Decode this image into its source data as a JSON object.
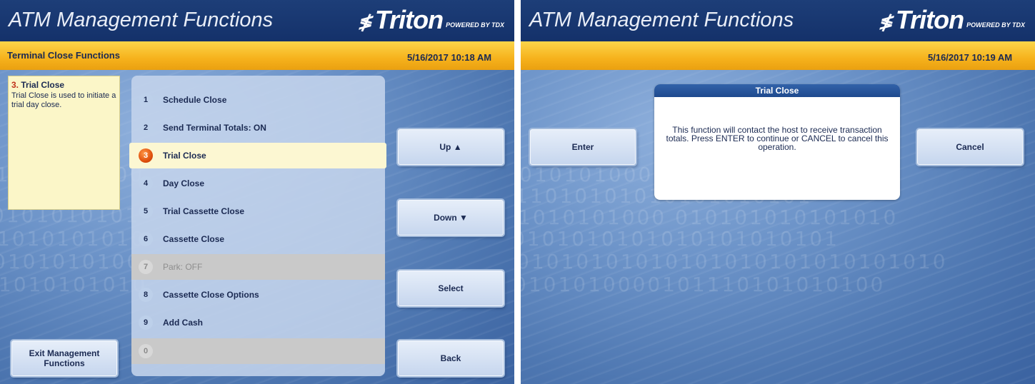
{
  "left_screen": {
    "header": {
      "title": "ATM Management Functions",
      "logo": "Triton",
      "logo_sub": "POWERED BY TDX"
    },
    "subbar": {
      "title": "Terminal Close Functions",
      "datetime": "5/16/2017  10:18 AM"
    },
    "help": {
      "number": "3.",
      "title": "Trial Close",
      "text": "Trial Close is used to initiate a trial day close."
    },
    "menu": [
      {
        "num": "1",
        "label": "Schedule Close",
        "state": "normal"
      },
      {
        "num": "2",
        "label": "Send Terminal Totals: ON",
        "state": "normal"
      },
      {
        "num": "3",
        "label": "Trial Close",
        "state": "selected"
      },
      {
        "num": "4",
        "label": "Day Close",
        "state": "normal"
      },
      {
        "num": "5",
        "label": "Trial Cassette Close",
        "state": "normal"
      },
      {
        "num": "6",
        "label": "Cassette Close",
        "state": "normal"
      },
      {
        "num": "7",
        "label": "Park: OFF",
        "state": "disabled"
      },
      {
        "num": "8",
        "label": "Cassette Close Options",
        "state": "normal"
      },
      {
        "num": "9",
        "label": "Add Cash",
        "state": "normal"
      },
      {
        "num": "0",
        "label": "",
        "state": "disabled"
      }
    ],
    "buttons": {
      "up": "Up ▲",
      "down": "Down ▼",
      "select": "Select",
      "back": "Back",
      "exit": "Exit Management Functions"
    },
    "binary_lines": [
      "1010101000",
      "0101010101",
      "1010101010",
      "0101010100",
      "1010101010"
    ]
  },
  "right_screen": {
    "header": {
      "title": "ATM Management Functions",
      "logo": "Triton",
      "logo_sub": "POWERED BY TDX"
    },
    "subbar": {
      "datetime": "5/16/2017  10:19 AM"
    },
    "dialog": {
      "title": "Trial Close",
      "message": "This function will contact the host to receive transaction totals.  Press ENTER to continue or CANCEL to cancel this operation."
    },
    "buttons": {
      "enter": "Enter",
      "cancel": "Cancel"
    },
    "binary_lines": [
      "01010100010101",
      "11010101010101010101",
      "1010101000 010101010101010",
      "0101010101010101010101",
      "01010101010101010101010101010",
      "0101010000101110101010100"
    ]
  },
  "colors": {
    "header": "#1d3e78",
    "subbar": "#f6b21c",
    "selected_row": "#fcf7d2",
    "selected_circle": "#e0500c",
    "help_box": "#fbf6c8",
    "text_dark": "#1b2a52"
  }
}
